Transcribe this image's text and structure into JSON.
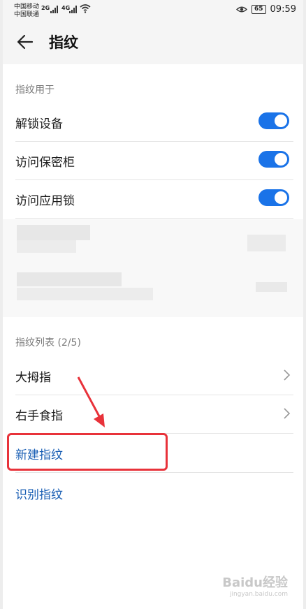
{
  "status_bar": {
    "carrier1": "中国移动",
    "carrier2": "中国联通",
    "net1": "2G",
    "net2": "4G",
    "battery": "65",
    "time": "09:59"
  },
  "header": {
    "title": "指纹"
  },
  "fingerprint_use": {
    "section_label": "指纹用于",
    "items": [
      {
        "label": "解锁设备",
        "enabled": true
      },
      {
        "label": "访问保密柜",
        "enabled": true
      },
      {
        "label": "访问应用锁",
        "enabled": true
      }
    ]
  },
  "fingerprint_list": {
    "section_label": "指纹列表 (2/5)",
    "items": [
      {
        "label": "大拇指"
      },
      {
        "label": "右手食指"
      }
    ],
    "new_label": "新建指纹",
    "identify_label": "识别指纹"
  },
  "watermark": {
    "brand": "Baidu经验",
    "url": "jingyan.baidu.com"
  },
  "colors": {
    "accent": "#1a73e8",
    "link": "#1a5fb4",
    "annotation": "#e8323a"
  }
}
